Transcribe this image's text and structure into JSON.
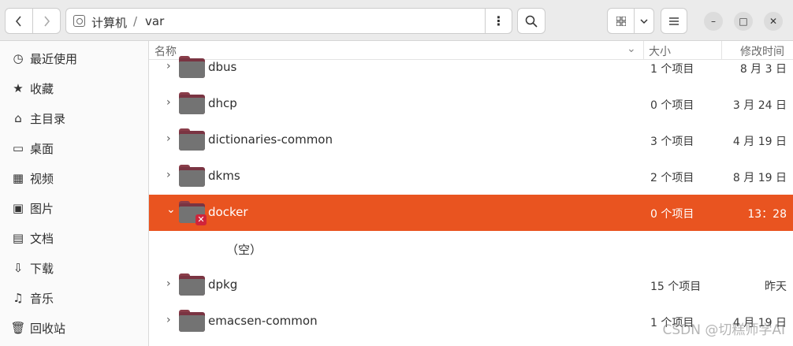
{
  "header": {
    "back_icon": "chevron-left-icon",
    "forward_icon": "chevron-right-icon",
    "breadcrumbs": [
      "计算机",
      "var"
    ],
    "separator": "/",
    "path_menu_icon": "⋮",
    "search_icon": "search-icon",
    "view_icon": "grid-icon",
    "view_dropdown_icon": "chevron-down-icon",
    "main_menu_icon": "hamburger-icon",
    "minimize": "–",
    "maximize": "□",
    "close": "✕"
  },
  "sidebar": {
    "items": [
      {
        "label": "最近使用",
        "icon": "◷"
      },
      {
        "label": "收藏",
        "icon": "★"
      },
      {
        "label": "主目录",
        "icon": "⌂"
      },
      {
        "label": "桌面",
        "icon": "▭"
      },
      {
        "label": "视频",
        "icon": "▦"
      },
      {
        "label": "图片",
        "icon": "▣"
      },
      {
        "label": "文档",
        "icon": "▤"
      },
      {
        "label": "下载",
        "icon": "⇩"
      },
      {
        "label": "音乐",
        "icon": "♫"
      },
      {
        "label": "回收站",
        "icon": "🗑"
      }
    ]
  },
  "columns": {
    "name": "名称",
    "size": "大小",
    "modified": "修改时间",
    "sort_icon": "⌄"
  },
  "rows": [
    {
      "name": "dbus",
      "size": "1 个项目",
      "date": "8 月 3 日"
    },
    {
      "name": "dhcp",
      "size": "0 个项目",
      "date": "3 月 24 日"
    },
    {
      "name": "dictionaries-common",
      "size": "3 个项目",
      "date": "4 月 19 日"
    },
    {
      "name": "dkms",
      "size": "2 个项目",
      "date": "8 月 19 日"
    },
    {
      "name": "docker",
      "size": "0 个项目",
      "date": "13：28"
    },
    {
      "name": "dpkg",
      "size": "15 个项目",
      "date": "昨天"
    },
    {
      "name": "emacsen-common",
      "size": "1 个项目",
      "date": "4 月 19 日"
    }
  ],
  "expanded_empty_text": "（空）",
  "watermark": "CSDN @切糕师学AI",
  "colors": {
    "accent": "#e95420",
    "folder": "#737373"
  }
}
